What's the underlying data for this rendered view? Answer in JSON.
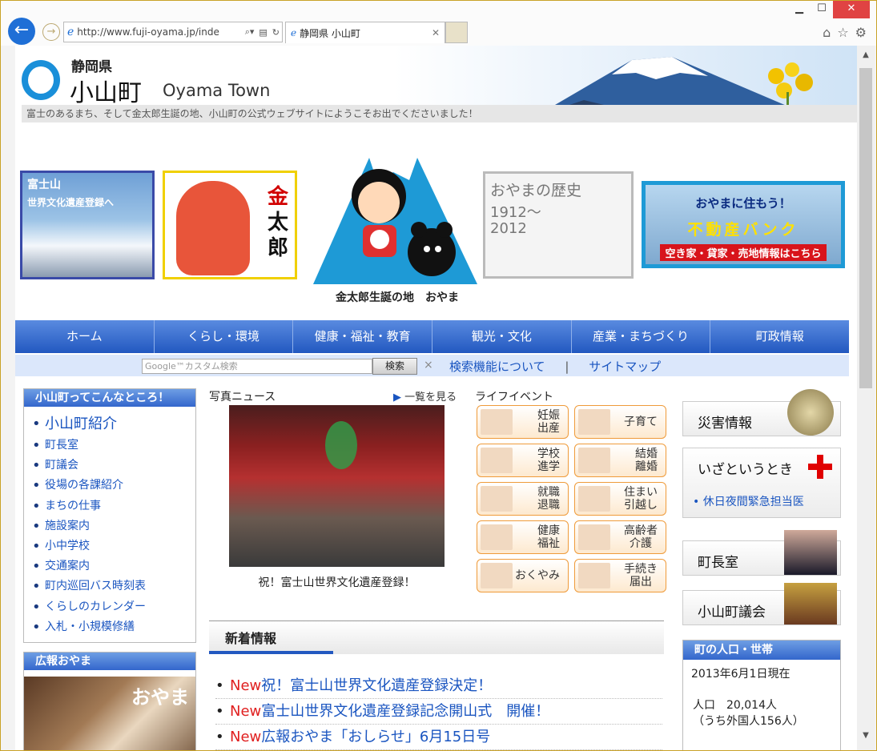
{
  "browser": {
    "url": "http://www.fuji-oyama.jp/inde",
    "tab_title": "静岡県 小山町"
  },
  "header": {
    "prefecture": "静岡県",
    "town": "小山町",
    "town_en": "Oyama Town",
    "tagline": "富士のあるまち、そして金太郎生誕の地、小山町の公式ウェブサイトにようこそお出でくださいました！"
  },
  "banners": {
    "fuji_l1": "富士山",
    "fuji_l2": "世界文化遺産登録へ",
    "kintaro_chars": [
      "金",
      "太",
      "郎"
    ],
    "birthplace": "金太郎生誕の地　おやま",
    "history_title": "おやまの歴史",
    "history_y1": "1912～",
    "history_y2": "2012",
    "bank_l1": "おやまに住もう！",
    "bank_l2": "不動産バンク",
    "bank_l3": "空き家・貸家・売地情報はこちら"
  },
  "nav": [
    "ホーム",
    "くらし・環境",
    "健康・福祉・教育",
    "観光・文化",
    "産業・まちづくり",
    "町政情報"
  ],
  "search": {
    "placeholder": "Google™カスタム検索",
    "button": "検索",
    "clear": "×",
    "link1": "検索機能について",
    "link2": "サイトマップ",
    "sep": "|"
  },
  "left": {
    "about_title": "小山町ってこんなところ！",
    "about_items": [
      "小山町紹介",
      "町長室",
      "町議会",
      "役場の各課紹介",
      "まちの仕事",
      "施設案内",
      "小中学校",
      "交通案内",
      "町内巡回バス時刻表",
      "くらしのカレンダー",
      "入札・小規模修繕"
    ],
    "pr_title": "広報おやま",
    "pr_logo": "おやま"
  },
  "middle": {
    "photo_title": "写真ニュース",
    "all_link": "一覧を見る",
    "photo_caption": "祝！富士山世界文化遺産登録！",
    "life_title": "ライフイベント",
    "events": [
      [
        "妊娠",
        "出産"
      ],
      [
        "子育て"
      ],
      [
        "学校",
        "進学"
      ],
      [
        "結婚",
        "離婚"
      ],
      [
        "就職",
        "退職"
      ],
      [
        "住まい",
        "引越し"
      ],
      [
        "健康",
        "福祉"
      ],
      [
        "高齢者",
        "介護"
      ],
      [
        "おくやみ"
      ],
      [
        "手続き",
        "届出"
      ]
    ],
    "news_title": "新着情報",
    "news_new": "New",
    "news": [
      "祝！富士山世界文化遺産登録決定！",
      "富士山世界文化遺産登録記念開山式　開催！",
      "広報おやま「おしらせ」6月15日号"
    ]
  },
  "right": {
    "disaster": "災害情報",
    "emergency": "いざというとき",
    "holiday_doctor": "休日夜間緊急担当医",
    "mayor": "町長室",
    "council": "小山町議会",
    "pop_title": "町の人口・世帯",
    "pop_date": "2013年6月1日現在",
    "pop_total": "人口　20,014人",
    "pop_foreign": "（うち外国人156人）"
  }
}
